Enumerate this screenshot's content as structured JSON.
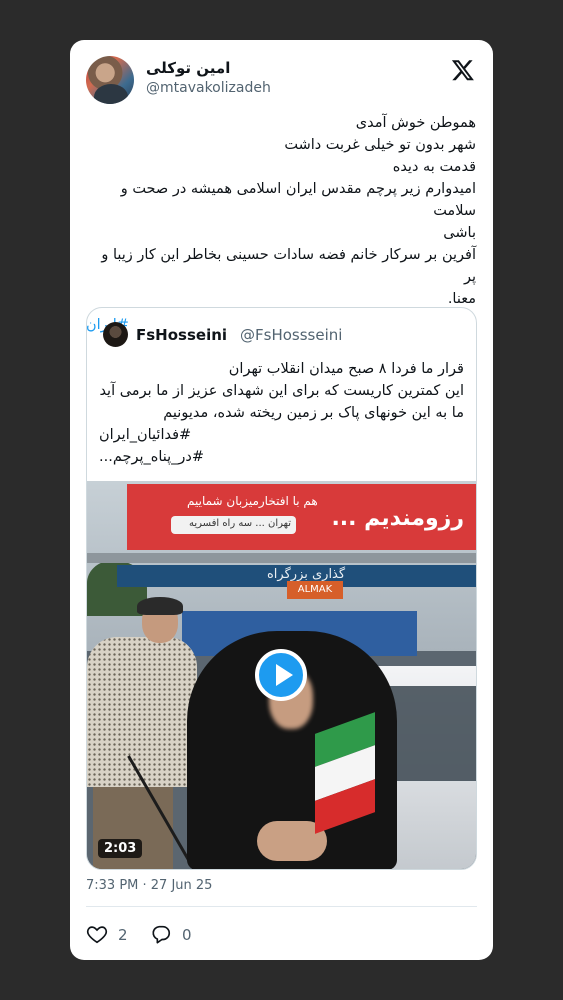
{
  "tweet": {
    "author_name": "امین توکلی",
    "handle": "@mtavakolizadeh",
    "lines": [
      "هموطن خوش آمدی",
      "شهر بدون تو خیلی غربت داشت",
      "قدمت به دیده",
      "امیدوارم زیر پرچم مقدس ایران اسلامی همیشه در صحت و سلامت",
      "باشی",
      "آفرین بر سرکار خانم فضه سادات حسینی بخاطر این کار زیبا و پر",
      "معنا."
    ],
    "hashtag": "#ایران",
    "timestamp": "7:33 PM · 27 Jun 25",
    "likes": "2",
    "replies": "0"
  },
  "quote": {
    "author_name": "FsHosseini",
    "handle": "@FsHossseini",
    "lines": [
      "قرار ما فردا ۸ صبح میدان انقلاب تهران",
      "این کمترین کاریست که برای این شهدای عزیز از ما برمی آید",
      "ما به این خونهای پاک بر زمین ریخته شده، مدیونیم"
    ],
    "hashtag1": "#فدائیان_ایران",
    "hashtag2": "#در_پناه_پرچم...",
    "video_duration": "2:03",
    "billboard_main": "رزومندیم ...",
    "billboard_top": "هم با افتخارمیزبان شماییم",
    "billboard_sub": "تهران ... سه راه افسریه",
    "road_sign": "گذاری بزرگراه",
    "truck_label": "ALMAK"
  },
  "icons": {
    "brand": "x-logo-icon",
    "like": "heart-icon",
    "reply": "reply-bubble-icon",
    "play": "play-icon"
  },
  "colors": {
    "link": "#1d9bf0",
    "muted": "#536471",
    "background": "#2b2b2b"
  }
}
